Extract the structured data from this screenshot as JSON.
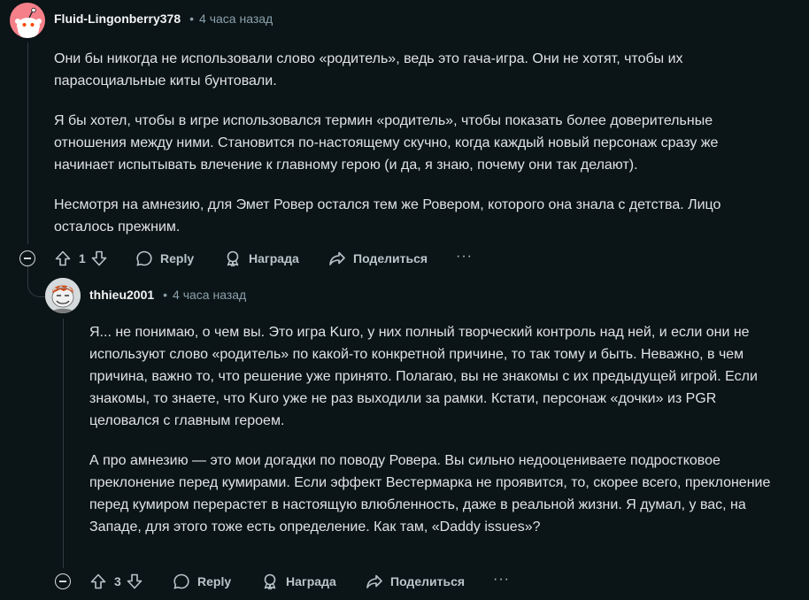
{
  "comment1": {
    "author": "Fluid-Lingonberry378",
    "time": "4 часа назад",
    "paragraphs": [
      "Они бы никогда не использовали слово «родитель», ведь это гача-игра. Они не хотят, чтобы их парасоциальные киты бунтовали.",
      "Я бы хотел, чтобы в игре использовался термин «родитель», чтобы показать более доверительные отношения между ними. Становится по-настоящему скучно, когда каждый новый персонаж сразу же начинает испытывать влечение к главному герою (и да, я знаю, почему они так делают).",
      "Несмотря на амнезию, для Эмет Ровер остался тем же Ровером, которого она знала с детства. Лицо осталось прежним."
    ],
    "votes": "1",
    "reply_label": "Reply",
    "award_label": "Награда",
    "share_label": "Поделиться",
    "more_label": "···"
  },
  "comment2": {
    "author": "thhieu2001",
    "time": "4 часа назад",
    "paragraphs": [
      "Я... не понимаю, о чем вы. Это игра Kuro, у них полный творческий контроль над ней, и если они не используют слово «родитель» по какой-то конкретной причине, то так тому и быть. Неважно, в чем причина, важно то, что решение уже принято. Полагаю, вы не знакомы с их предыдущей игрой. Если знакомы, то знаете, что Kuro уже не раз выходили за рамки. Кстати, персонаж «дочки» из PGR целовался с главным героем.",
      "А про амнезию — это мои догадки по поводу Ровера. Вы сильно недооцениваете подростковое преклонение перед кумирами. Если эффект Вестермарка не проявится, то, скорее всего, преклонение перед кумиром перерастет в настоящую влюбленность, даже в реальной жизни. Я думал, у вас, на Западе, для этого тоже есть определение. Как там, «Daddy issues»?"
    ],
    "votes": "3",
    "reply_label": "Reply",
    "award_label": "Награда",
    "share_label": "Поделиться",
    "more_label": "···"
  },
  "separator": "•",
  "icons": [
    "snoo-avatar-icon",
    "user-avatar-icon",
    "collapse-icon",
    "upvote-icon",
    "downvote-icon",
    "reply-icon",
    "award-icon",
    "share-icon",
    "more-icon"
  ]
}
